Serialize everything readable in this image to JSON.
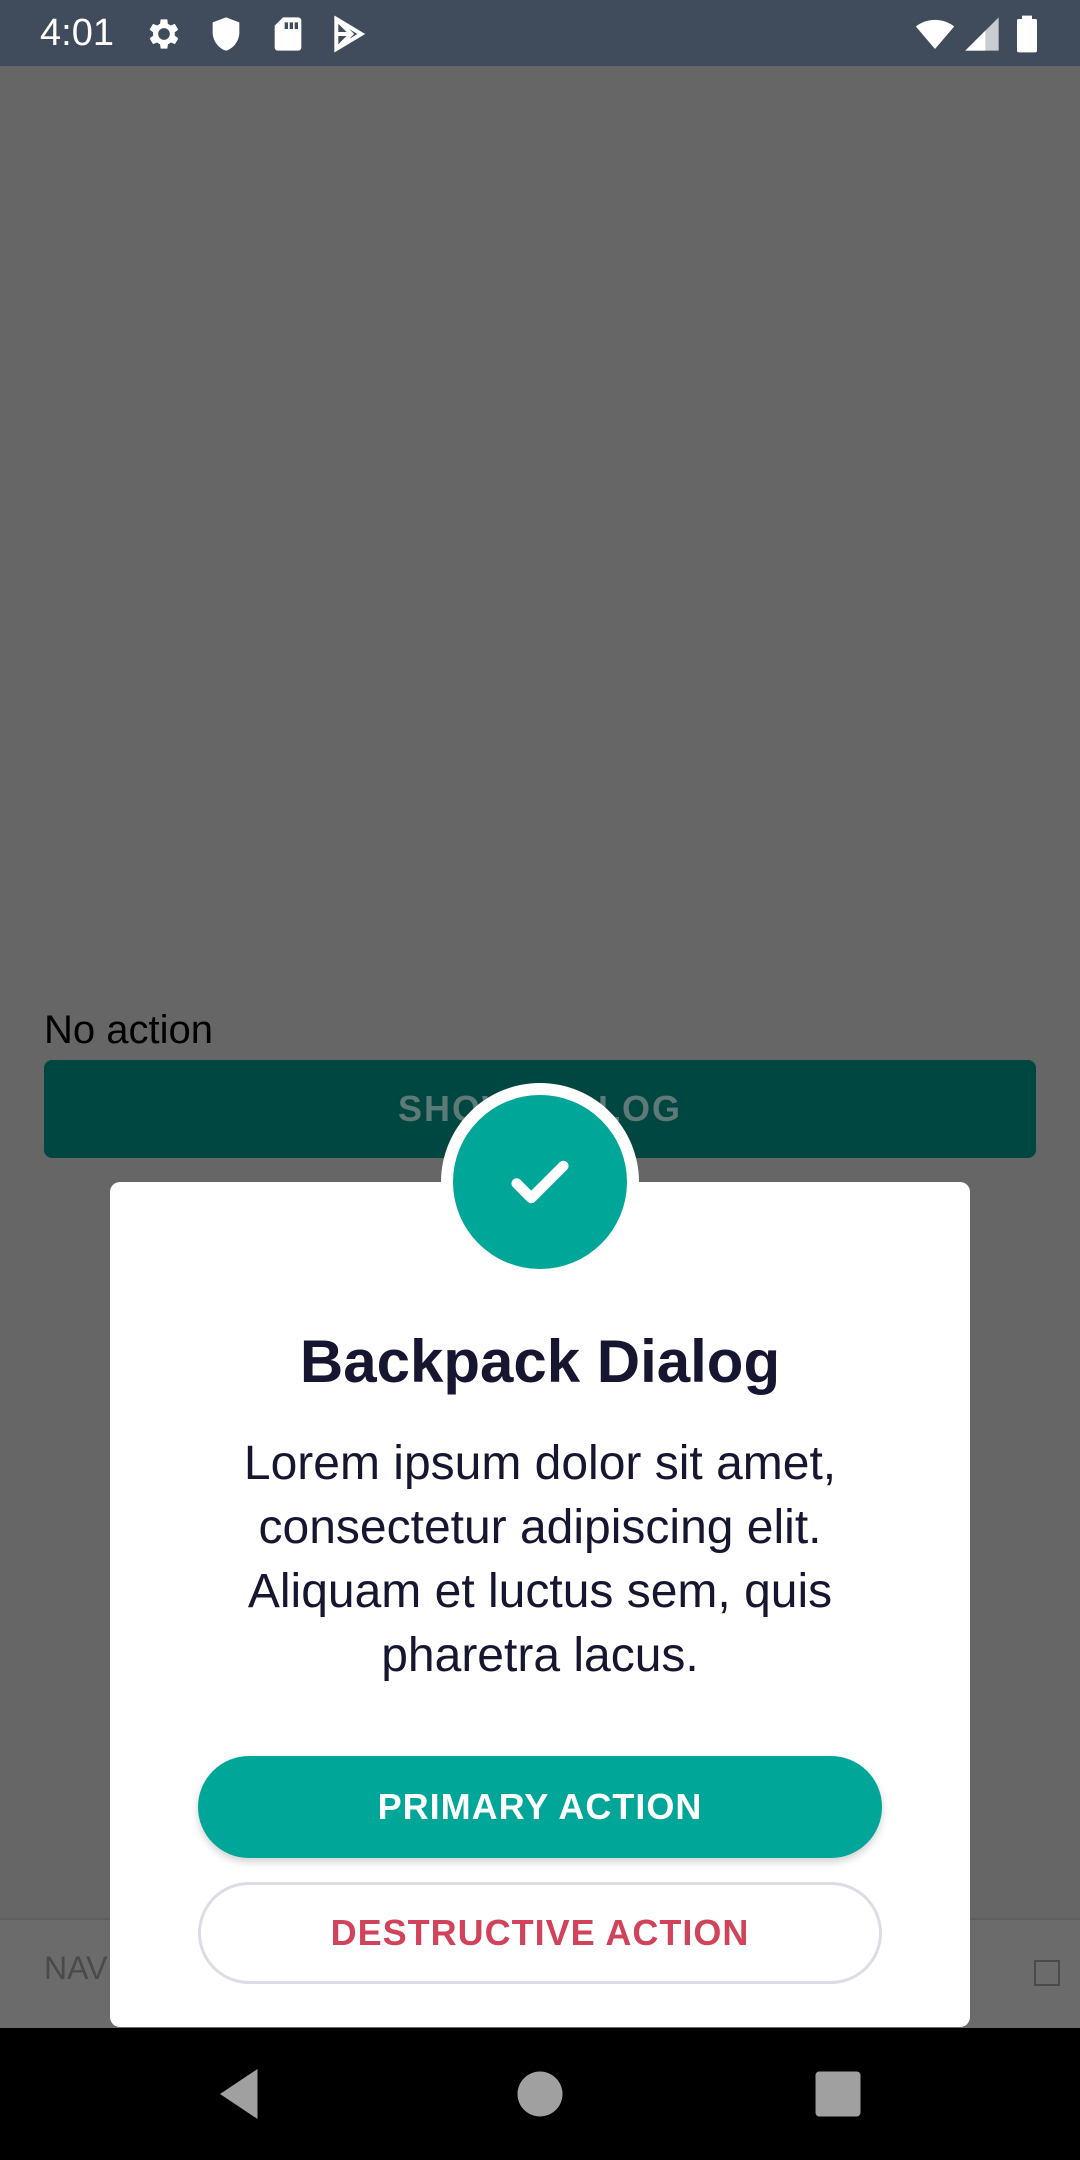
{
  "status_bar": {
    "time": "4:01",
    "icons": [
      "gear-icon",
      "shield-icon",
      "sd-card-icon",
      "play-store-icon",
      "wifi-icon",
      "signal-icon",
      "battery-icon"
    ]
  },
  "background": {
    "label": "No action",
    "button_label": "SHOW DIALOG",
    "bottom_bar_text": "NAVI"
  },
  "dialog": {
    "icon": "check-icon",
    "title": "Backpack Dialog",
    "body": "Lorem ipsum dolor sit amet, consectetur adipiscing elit. Aliquam et luctus sem, quis pharetra lacus.",
    "primary_action": "PRIMARY ACTION",
    "destructive_action": "DESTRUCTIVE ACTION"
  },
  "nav_bar": {
    "buttons": [
      "back-icon",
      "home-icon",
      "recents-icon"
    ]
  },
  "colors": {
    "accent": "#00a698",
    "destructive": "#d1435b",
    "text_dark": "#161631",
    "scrim": "#666666"
  }
}
